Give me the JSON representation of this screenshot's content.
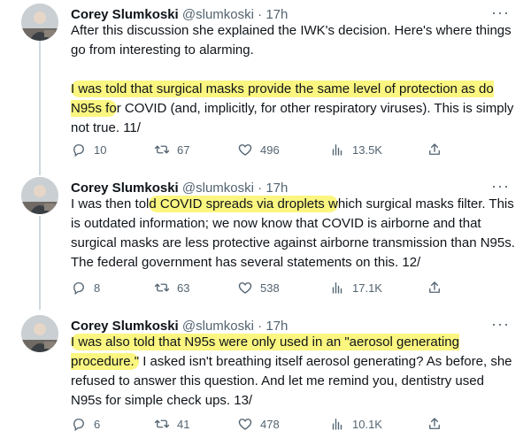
{
  "tweets": [
    {
      "author_name": "Corey Slumkoski",
      "handle": "@slumkoski",
      "separator": "·",
      "time": "17h",
      "text_plain_1": "After this discussion she explained the IWK's decision. Here's where things go from interesting to alarming.",
      "text_hl_1": "I was told that surgical masks provide the same level of protection as do N95s fo",
      "text_plain_2": "r COVID (and, implicitly, for other respiratory viruses). This is simply not true. 11/",
      "replies": "10",
      "retweets": "67",
      "likes": "496",
      "views": "13.5K"
    },
    {
      "author_name": "Corey Slumkoski",
      "handle": "@slumkoski",
      "separator": "·",
      "time": "17h",
      "text_plain_1": "I was then tol",
      "text_hl_1": "d COVID spreads via droplets w",
      "text_plain_2": "hich surgical masks filter. This is outdated information; we now know that COVID is airborne and that surgical masks are less protective against airborne transmission than N95s. The federal government has several statements on this. 12/",
      "replies": "8",
      "retweets": "63",
      "likes": "538",
      "views": "17.1K"
    },
    {
      "author_name": "Corey Slumkoski",
      "handle": "@slumkoski",
      "separator": "·",
      "time": "17h",
      "text_hl_1": "I was also told that N95s were only used in an \"aerosol generating procedure.\"",
      "text_plain_1": " I asked isn't breathing itself aerosol generating? As before, she refused to answer this question. And let me remind you, dentistry used N95s for simple check ups. 13/",
      "replies": "6",
      "retweets": "41",
      "likes": "478",
      "views": "10.1K"
    }
  ],
  "more_glyph": "···",
  "colors": {
    "highlight": "#fbf680",
    "muted": "#536471",
    "thread_line": "#cfd9de"
  },
  "icons": [
    "reply-icon",
    "retweet-icon",
    "like-icon",
    "views-icon",
    "share-icon",
    "more-icon"
  ]
}
